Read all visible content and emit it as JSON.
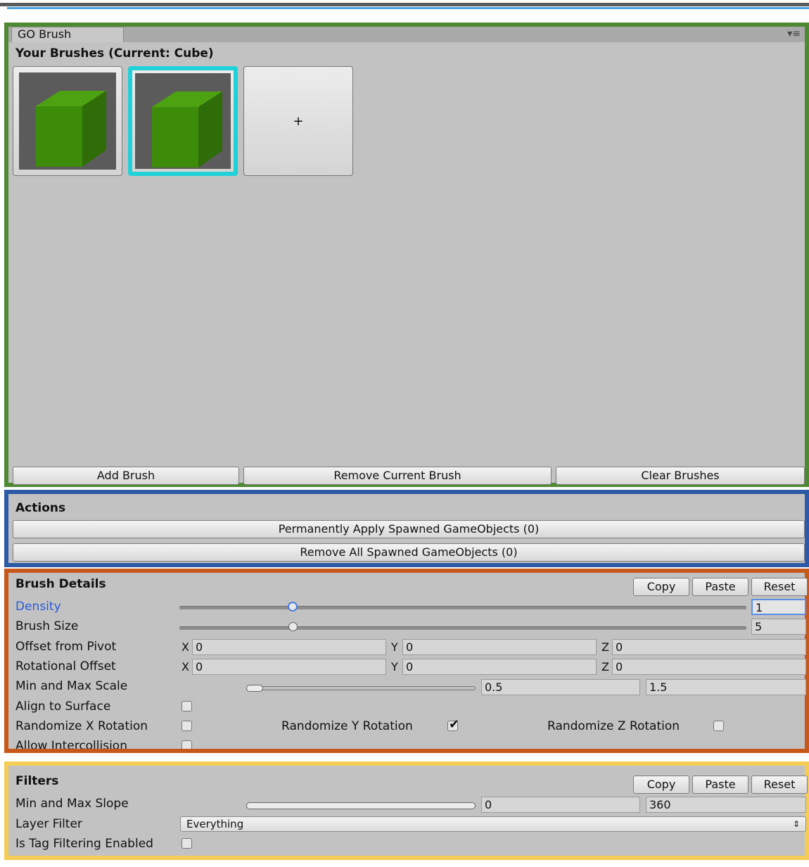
{
  "window": {
    "tab_title": "GO Brush",
    "menu_icon": "menu-icon"
  },
  "brushes": {
    "header": "Your Brushes (Current: Cube)",
    "items": [
      {
        "name": "Cube",
        "selected": false
      },
      {
        "name": "Cube",
        "selected": true
      }
    ],
    "add_tile_label": "+",
    "add_button": "Add Brush",
    "remove_button": "Remove Current Brush",
    "clear_button": "Clear Brushes"
  },
  "actions": {
    "header": "Actions",
    "apply_button": "Permanently Apply Spawned GameObjects (0)",
    "remove_all_button": "Remove All Spawned GameObjects (0)"
  },
  "brush_details": {
    "header": "Brush Details",
    "copy": "Copy",
    "paste": "Paste",
    "reset": "Reset",
    "density": {
      "label": "Density",
      "value": "1",
      "slider_fraction": 0.2
    },
    "brush_size": {
      "label": "Brush Size",
      "value": "5",
      "slider_fraction": 0.2
    },
    "offset_from_pivot": {
      "label": "Offset from Pivot",
      "x_label": "X",
      "y_label": "Y",
      "z_label": "Z",
      "x": "0",
      "y": "0",
      "z": "0"
    },
    "rotational_offset": {
      "label": "Rotational Offset",
      "x_label": "X",
      "y_label": "Y",
      "z_label": "Z",
      "x": "0",
      "y": "0",
      "z": "0"
    },
    "min_max_scale": {
      "label": "Min and Max Scale",
      "min": "0.5",
      "max": "1.5"
    },
    "align_to_surface": {
      "label": "Align to Surface",
      "checked": false
    },
    "randomize_x": {
      "label": "Randomize X Rotation",
      "checked": false
    },
    "randomize_y": {
      "label": "Randomize Y Rotation",
      "checked": true
    },
    "randomize_z": {
      "label": "Randomize Z Rotation",
      "checked": false
    },
    "allow_intercollision": {
      "label": "Allow Intercollision",
      "checked": false
    }
  },
  "filters": {
    "header": "Filters",
    "copy": "Copy",
    "paste": "Paste",
    "reset": "Reset",
    "min_max_slope": {
      "label": "Min and Max Slope",
      "min": "0",
      "max": "360"
    },
    "layer_filter": {
      "label": "Layer Filter",
      "value": "Everything"
    },
    "tag_filtering": {
      "label": "Is Tag Filtering Enabled",
      "checked": false
    }
  },
  "colors": {
    "panel_bg": "#c2c2c2",
    "green_frame": "#4e8a33",
    "blue_frame": "#2d5aa6",
    "orange_frame": "#c8571a",
    "yellow_frame": "#f5cd55",
    "selected_brush": "#1fd2d8",
    "cube": "#3f8f0c"
  }
}
